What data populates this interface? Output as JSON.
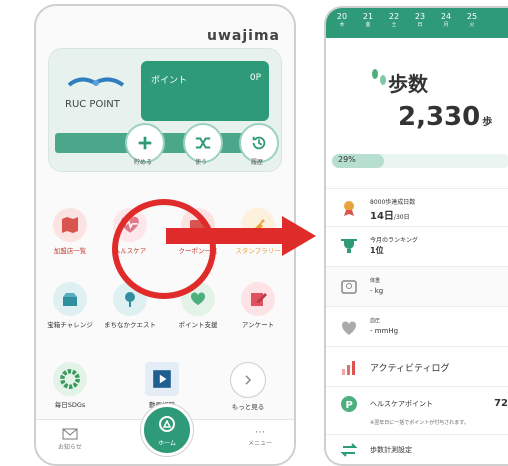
{
  "left_app": {
    "brand": "uwajima",
    "logo_text": "RUC POINT",
    "points_label": "ポイント",
    "points_value": "0P",
    "actions": [
      {
        "label": "貯める",
        "icon": "plus-icon"
      },
      {
        "label": "使う",
        "icon": "shuffle-icon"
      },
      {
        "label": "履歴",
        "icon": "history-icon"
      }
    ],
    "grid": [
      {
        "label": "加盟店一覧",
        "icon": "map-icon",
        "color": "#d9534f"
      },
      {
        "label": "ヘルスケア",
        "icon": "heart-pulse-icon",
        "color": "#e07a8a"
      },
      {
        "label": "クーポン一覧",
        "icon": "coupon-icon",
        "color": "#d9534f"
      },
      {
        "label": "スタンプラリー",
        "icon": "stamp-icon",
        "color": "#e8a33d"
      },
      {
        "label": "宝箱チャレンジ",
        "icon": "treasure-icon",
        "color": "#2f8f9f"
      },
      {
        "label": "まちなかクエスト",
        "icon": "quest-icon",
        "color": "#2f8f9f"
      },
      {
        "label": "ポイント支援",
        "icon": "support-heart-icon",
        "color": "#4caf7d"
      },
      {
        "label": "アンケート",
        "icon": "edit-icon",
        "color": "#e05260"
      },
      {
        "label": "毎日SDGs",
        "icon": "sdgs-icon",
        "color": "#3a9a5b"
      },
      {
        "label": "動画視聴",
        "icon": "video-icon",
        "color": "#1f5f8f"
      },
      {
        "label": "もっと見る",
        "icon": "chevron-right-icon",
        "color": "#888888"
      }
    ],
    "nav": {
      "left": "お知らせ",
      "home": "ホーム",
      "right": "メニュー"
    }
  },
  "right_app": {
    "dates": [
      {
        "day": "20",
        "dow": "木"
      },
      {
        "day": "21",
        "dow": "金"
      },
      {
        "day": "22",
        "dow": "土"
      },
      {
        "day": "23",
        "dow": "日"
      },
      {
        "day": "24",
        "dow": "月"
      },
      {
        "day": "25",
        "dow": "火"
      }
    ],
    "title": "歩数",
    "steps": "2,330",
    "steps_unit": "歩",
    "progress_label": "29%",
    "progress_fraction": 0.29,
    "rows": {
      "achieve_label": "8000歩達成日数",
      "achieve_value": "14日",
      "achieve_sub": "/30日",
      "rank_label": "今月のランキング",
      "rank_value": "1位",
      "weight_label": "体重",
      "weight_value": "- kg",
      "bp_label": "血圧",
      "bp_value": "- mmHg",
      "activity_log": "アクティビティログ",
      "hc_points": "ヘルスケアポイント",
      "hc_points_value": "72",
      "hc_note": "※翌年日に一括でポイントが付与されます。",
      "step_settings": "歩数計測設定"
    }
  },
  "colors": {
    "primary": "#2f9a78",
    "highlight": "#e02b2b"
  }
}
